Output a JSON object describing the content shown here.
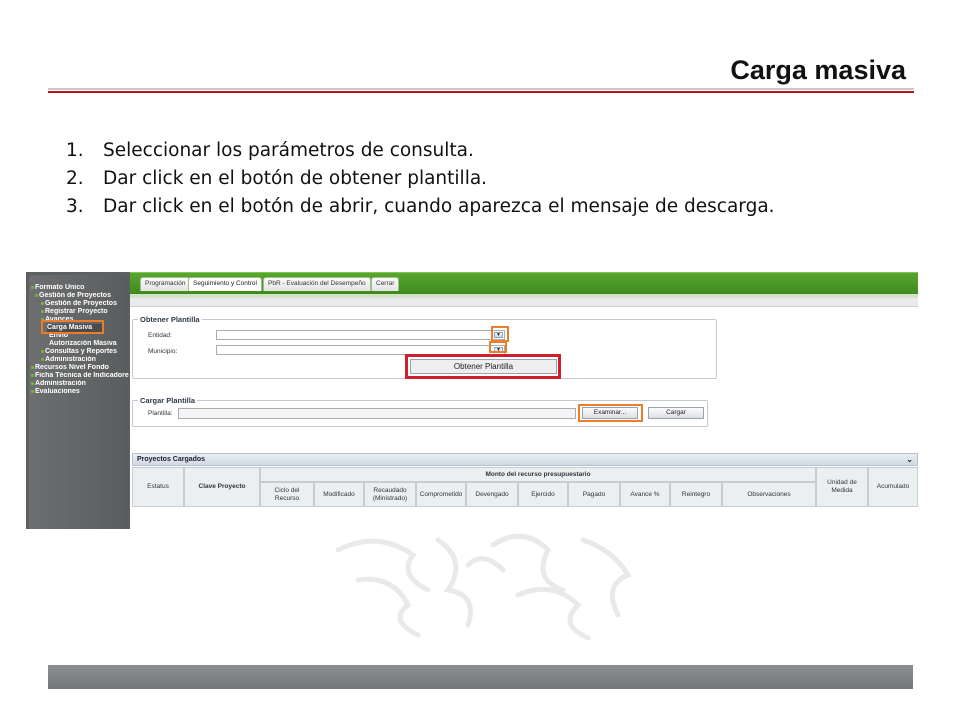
{
  "slide": {
    "title": "Carga masiva",
    "steps": [
      {
        "num": "1.",
        "text": "Seleccionar los parámetros de consulta."
      },
      {
        "num": "2.",
        "text": "Dar click en el botón de obtener plantilla."
      },
      {
        "num": "3.",
        "text": "Dar click en el botón de abrir, cuando aparezca  el mensaje de descarga."
      }
    ]
  },
  "app": {
    "sidebar": {
      "items": [
        "Formato Único",
        "Gestión de Proyectos",
        "Gestión de Proyectos",
        "Registrar Proyecto",
        "Avances",
        "Carga Masiva",
        "Envío",
        "Autorización Masiva",
        "Consultas y Reportes",
        "Administración",
        "Recursos Nivel Fondo",
        "Ficha Técnica de Indicadores",
        "Administración",
        "Evaluaciones"
      ]
    },
    "tabs": [
      "Programación",
      "Seguimiento y Control",
      "PbR - Evaluación del Desempeño",
      "Cerrar"
    ],
    "active_tab": "Seguimiento y Control",
    "obtener": {
      "legend": "Obtener Plantilla",
      "entidad_label": "Entidad:",
      "municipio_label": "Municipio:",
      "button": "Obtener Plantilla"
    },
    "cargar": {
      "legend": "Cargar Plantilla",
      "plantilla_label": "Plantilla:",
      "examinar": "Examinar...",
      "cargar": "Cargar"
    },
    "grid": {
      "title": "Proyectos Cargados",
      "col_estatus": "Estatus",
      "col_clave": "Clave Proyecto",
      "group": "Monto del recurso presupuestario",
      "columns": [
        "Ciclo del Recurso",
        "Modificado",
        "Recaudado (Ministrado)",
        "Comprometido",
        "Devengado",
        "Ejercido",
        "Pagado",
        "Avance %",
        "Reintegro",
        "Observaciones",
        "Unidad de Medida",
        "Acumulado"
      ]
    }
  }
}
